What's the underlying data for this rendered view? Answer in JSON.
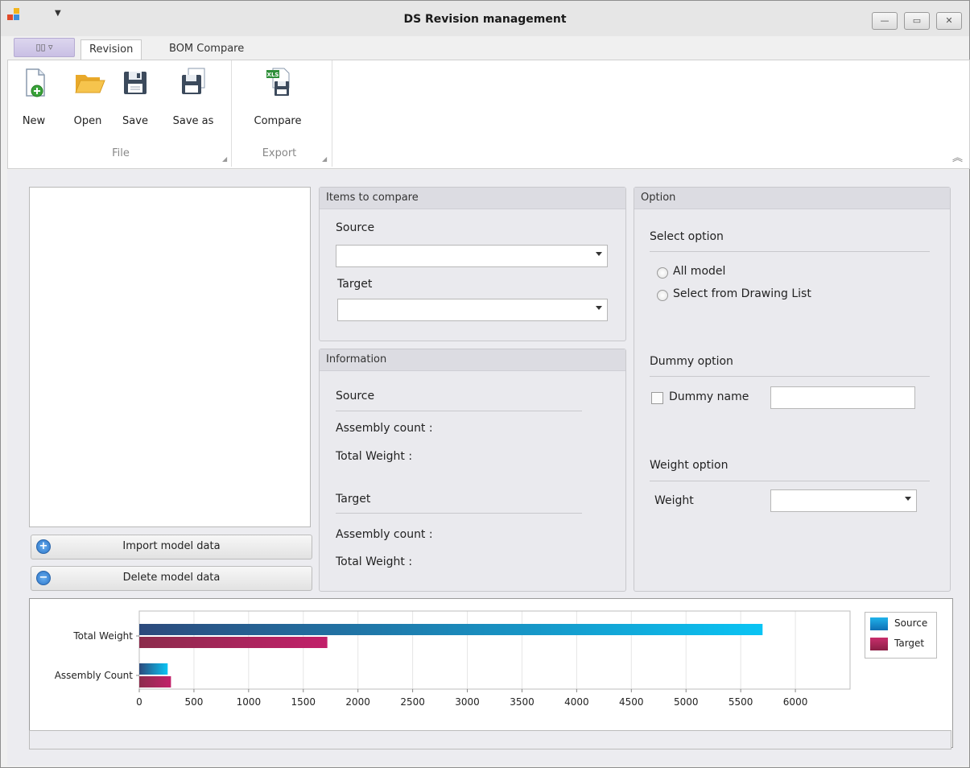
{
  "window": {
    "title": "DS Revision management",
    "buttons": {
      "minimize": "—",
      "maximize": "▭",
      "close": "✕"
    }
  },
  "ribbon": {
    "tabs": [
      "Revision",
      "BOM Compare"
    ],
    "active_tab": "Revision",
    "file_group": {
      "label": "File",
      "buttons": [
        {
          "label": "New",
          "icon": "new-document-icon"
        },
        {
          "label": "Open",
          "icon": "folder-open-icon"
        },
        {
          "label": "Save",
          "icon": "floppy-disk-icon"
        },
        {
          "label": "Save as",
          "icon": "save-as-icon"
        }
      ]
    },
    "export_group": {
      "label": "Export",
      "buttons": [
        {
          "label": "Compare",
          "icon": "xls-export-icon"
        }
      ]
    }
  },
  "left_panel": {
    "import_button": "Import model data",
    "delete_button": "Delete model data"
  },
  "items_to_compare": {
    "header": "Items to compare",
    "source_label": "Source",
    "target_label": "Target",
    "source_value": "",
    "target_value": ""
  },
  "information": {
    "header": "Information",
    "source_label": "Source",
    "source_assembly_count": "Assembly count :",
    "source_total_weight": "Total Weight :",
    "target_label": "Target",
    "target_assembly_count": "Assembly count :",
    "target_total_weight": "Total Weight :"
  },
  "option": {
    "header": "Option",
    "select_option_label": "Select option",
    "radio_all_model": "All model",
    "radio_drawing_list": "Select from Drawing List",
    "dummy_option_label": "Dummy option",
    "dummy_name_label": "Dummy name",
    "dummy_name_value": "",
    "weight_option_label": "Weight option",
    "weight_label": "Weight",
    "weight_value": ""
  },
  "chart_data": {
    "type": "bar",
    "orientation": "horizontal",
    "categories": [
      "Total Weight",
      "Assembly Count"
    ],
    "series": [
      {
        "name": "Source",
        "values": [
          5700,
          260
        ],
        "color": "#1a8fd8"
      },
      {
        "name": "Target",
        "values": [
          1720,
          290
        ],
        "color": "#b3245a"
      }
    ],
    "xlim": [
      0,
      6500
    ],
    "xticks": [
      0,
      500,
      1000,
      1500,
      2000,
      2500,
      3000,
      3500,
      4000,
      4500,
      5000,
      5500,
      6000
    ],
    "grid": true,
    "legend_position": "top-right",
    "title": "",
    "xlabel": "",
    "ylabel": ""
  }
}
